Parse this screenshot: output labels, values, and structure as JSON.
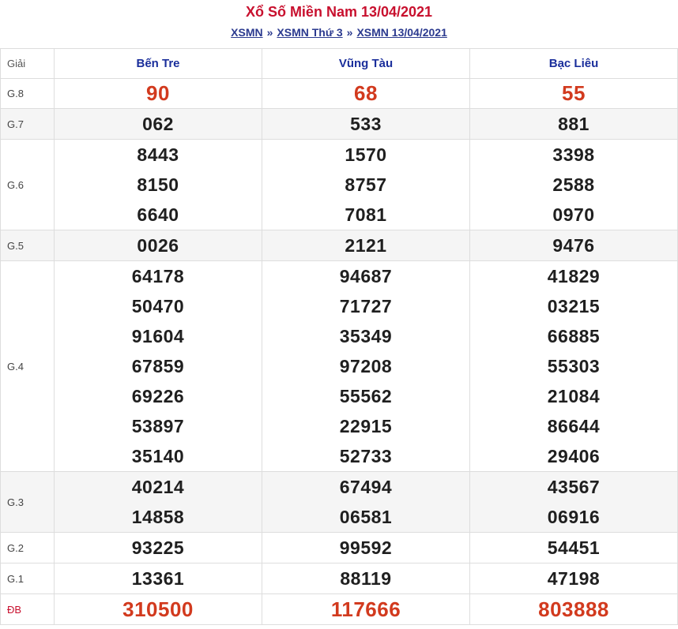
{
  "header": {
    "title": "Xổ Số Miền Nam 13/04/2021",
    "breadcrumb": [
      {
        "label": "XSMN"
      },
      {
        "label": "XSMN Thứ 3"
      },
      {
        "label": "XSMN 13/04/2021"
      }
    ],
    "separator": "»"
  },
  "table": {
    "label_header": "Giải",
    "provinces": [
      "Bến Tre",
      "Vũng Tàu",
      "Bạc Liêu"
    ],
    "rows": [
      {
        "label": "G.8",
        "values": [
          [
            "90"
          ],
          [
            "68"
          ],
          [
            "55"
          ]
        ]
      },
      {
        "label": "G.7",
        "values": [
          [
            "062"
          ],
          [
            "533"
          ],
          [
            "881"
          ]
        ]
      },
      {
        "label": "G.6",
        "values": [
          [
            "8443",
            "8150",
            "6640"
          ],
          [
            "1570",
            "8757",
            "7081"
          ],
          [
            "3398",
            "2588",
            "0970"
          ]
        ]
      },
      {
        "label": "G.5",
        "values": [
          [
            "0026"
          ],
          [
            "2121"
          ],
          [
            "9476"
          ]
        ]
      },
      {
        "label": "G.4",
        "values": [
          [
            "64178",
            "50470",
            "91604",
            "67859",
            "69226",
            "53897",
            "35140"
          ],
          [
            "94687",
            "71727",
            "35349",
            "97208",
            "55562",
            "22915",
            "52733"
          ],
          [
            "41829",
            "03215",
            "66885",
            "55303",
            "21084",
            "86644",
            "29406"
          ]
        ]
      },
      {
        "label": "G.3",
        "values": [
          [
            "40214",
            "14858"
          ],
          [
            "67494",
            "06581"
          ],
          [
            "43567",
            "06916"
          ]
        ]
      },
      {
        "label": "G.2",
        "values": [
          [
            "93225"
          ],
          [
            "99592"
          ],
          [
            "54451"
          ]
        ]
      },
      {
        "label": "G.1",
        "values": [
          [
            "13361"
          ],
          [
            "88119"
          ],
          [
            "47198"
          ]
        ]
      },
      {
        "label": "ĐB",
        "values": [
          [
            "310500"
          ],
          [
            "117666"
          ],
          [
            "803888"
          ]
        ]
      }
    ]
  },
  "colors": {
    "title": "#c8102e",
    "province": "#1a2e9b",
    "highlight_number": "#d23a1e",
    "alt_row": "#f5f5f5"
  }
}
